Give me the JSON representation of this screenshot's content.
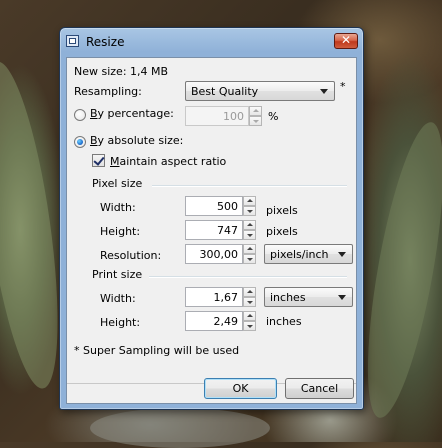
{
  "window": {
    "title": "Resize",
    "close_glyph": "✕"
  },
  "info": {
    "new_size": "New size: 1,4 MB"
  },
  "resampling": {
    "label": "Resampling:",
    "value": "Best Quality",
    "footnote_mark": "*"
  },
  "by_percentage": {
    "label": "By percentage:",
    "selected": false,
    "value": "100",
    "unit": "%"
  },
  "by_absolute": {
    "label": "By absolute size:",
    "selected": true
  },
  "maintain_aspect": {
    "label": "Maintain aspect ratio",
    "checked": true
  },
  "pixel_size": {
    "heading": "Pixel size",
    "width_label": "Width:",
    "width_value": "500",
    "width_unit": "pixels",
    "height_label": "Height:",
    "height_value": "747",
    "height_unit": "pixels",
    "resolution_label": "Resolution:",
    "resolution_value": "300,00",
    "resolution_unit": "pixels/inch"
  },
  "print_size": {
    "heading": "Print size",
    "width_label": "Width:",
    "width_value": "1,67",
    "width_unit": "inches",
    "height_label": "Height:",
    "height_value": "2,49",
    "height_unit": "inches"
  },
  "note": "* Super Sampling will be used",
  "buttons": {
    "ok": "OK",
    "cancel": "Cancel"
  },
  "colors": {
    "title_bar": "#8fb1d8",
    "client_bg": "#f0f0f0",
    "close_button": "#c0391d",
    "default_button_border": "#3c7fb1"
  }
}
